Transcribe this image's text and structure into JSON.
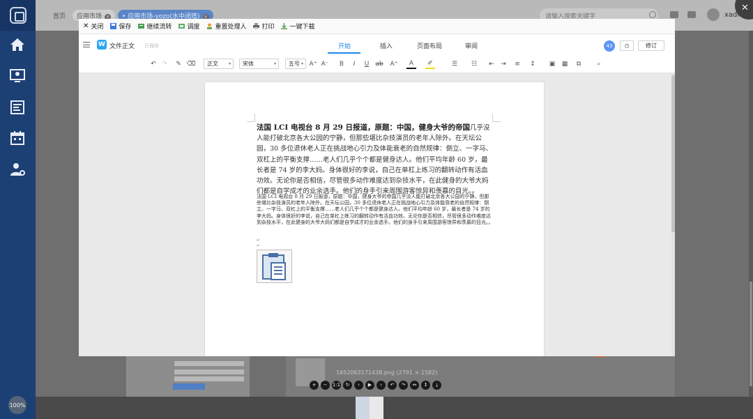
{
  "background_app": {
    "tabs": [
      {
        "label": "首页"
      },
      {
        "label": "应用市场"
      },
      {
        "label": "• 应用市场-yozo(水中闭塔)"
      }
    ],
    "search_placeholder": "请输入搜索关键字",
    "user": "xadmin",
    "zoom": "100%",
    "image_filename": "1652063171438.png (2791 × 1582)",
    "viewer_buttons": [
      "+",
      "−",
      "1:1",
      "↻",
      "‹",
      "▶",
      "›",
      "↶",
      "↷",
      "↔",
      "↕",
      "⤓"
    ]
  },
  "editor": {
    "toolbar_actions": [
      {
        "label": "关闭",
        "icon": "close-icon"
      },
      {
        "label": "保存",
        "icon": "save-icon"
      },
      {
        "label": "继续流转",
        "icon": "flow-icon"
      },
      {
        "label": "调度",
        "icon": "schedule-icon"
      },
      {
        "label": "重置处理人",
        "icon": "reset-handler-icon"
      },
      {
        "label": "打印",
        "icon": "print-icon"
      },
      {
        "label": "一键下载",
        "icon": "download-icon"
      }
    ],
    "doc_name": "文件正文",
    "save_status": "已保存",
    "ribbon_tabs": [
      {
        "label": "开始",
        "active": true
      },
      {
        "label": "插入",
        "active": false
      },
      {
        "label": "页面布局",
        "active": false
      },
      {
        "label": "审阅",
        "active": false
      }
    ],
    "badge_count": "43",
    "revise_label": "修订",
    "style_select": "正文",
    "font_select": "宋体",
    "size_select": "五号",
    "accent_color": "#1f87e8"
  },
  "document": {
    "para1_lead": "法国 LCI 电视台 8 月 29 日报道，原题：中国，健身大爷的帝国",
    "para1_rest": "几乎没人能打破北京各大公园的宁静，但那些堪比杂技演员的老年人除外。在天坛公园，30 多位退休老人正在挑战地心引力及体能衰老的自然规律：倒立、一字马、双杠上的平衡支撑……老人们几乎个个都是健身达人。他们平均年龄 60 岁，最长者是 74 岁的李大妈。身体很好的李说，自己在单杠上练习的翻转动作有活血功效。无论你是否相信，尽管很多动作难度达到杂技水平，在此健身的大爷大妈们都是自学成才的业余选手。他们的身手引来周围游客惊异和羡慕的目光。。",
    "para2": "法国 LCI 电视台 8 月 29 日报道，原题：中国，健身大爷的帝国几乎没人能打破北京各大公园的宁静，但那些堪比杂技演员的老年人除外。在天坛公园，30 多位退休老人正在挑战地心引力及体能衰老的自然规律：倒立、一字马、双杠上的平衡支撑……老人们几乎个个都是健身达人。他们平均年龄 60 岁，最长者是 74 岁的李大妈。身体很好的李说，自己在单杠上练习的翻转动作有活血功效。无论你是否相信，尽管很多动作难度达到杂技水平，在此健身的大爷大妈们都是自学成才的业余选手。他们的身手引来周围游客惊异和羡慕的目光。。",
    "para_marks": [
      "↵",
      "↵"
    ]
  }
}
